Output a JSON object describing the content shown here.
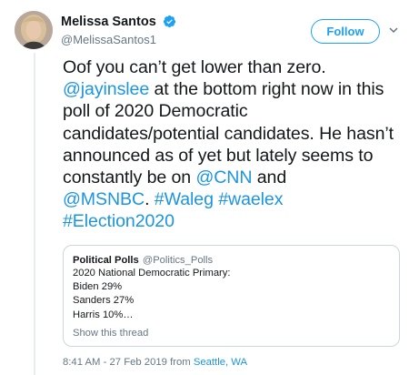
{
  "author": {
    "display_name": "Melissa Santos",
    "handle": "@MelissaSantos1",
    "verified_icon": "verified-badge-icon",
    "avatar_icon": "avatar"
  },
  "actions": {
    "follow_label": "Follow",
    "more_icon": "chevron-down-icon"
  },
  "tweet": {
    "text_1": "Oof you can’t get lower than zero. ",
    "mention_inslee": "@jayinslee",
    "text_2": " at the bottom right now in this poll of 2020 Democratic candidates/potential candidates. He hasn’t announced as of yet but lately seems to constantly be on ",
    "mention_cnn": "@CNN",
    "text_3": " and ",
    "mention_msnbc": "@MSNBC",
    "text_4": ". ",
    "hashtag_waleg": "#Waleg",
    "text_5": " ",
    "hashtag_waelex": "#waelex",
    "hashtag_election": "#Election2020"
  },
  "quoted_tweet": {
    "name": "Political Polls",
    "handle": "@Politics_Polls",
    "lines": [
      "2020 National Democratic Primary:",
      "Biden 29%",
      "Sanders 27%",
      "Harris 10%…"
    ],
    "show_thread": "Show this thread"
  },
  "metadata": {
    "timestamp": "8:41 AM - 27 Feb 2019 from ",
    "location": "Seattle, WA"
  },
  "colors": {
    "link": "#1b95e0",
    "follow_blue": "#1da1f2",
    "secondary_text": "#657786",
    "border": "#ccd6dd"
  }
}
